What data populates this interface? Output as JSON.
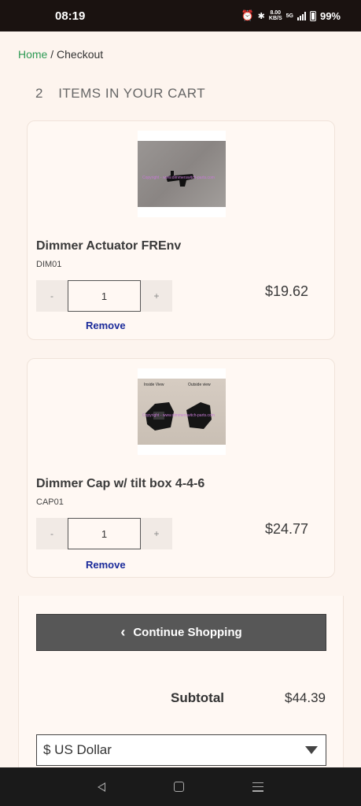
{
  "status_bar": {
    "time": "08:19",
    "net_speed": "8.00",
    "net_unit": "KB/S",
    "network_type": "5G",
    "battery": "99%"
  },
  "breadcrumb": {
    "home": "Home",
    "separator": "/",
    "current": "Checkout"
  },
  "cart": {
    "count": "2",
    "heading": "ITEMS IN YOUR CART",
    "items": [
      {
        "name": "Dimmer Actuator FREnv",
        "sku": "DIM01",
        "quantity": "1",
        "minus": "-",
        "plus": "+",
        "price": "$19.62",
        "remove": "Remove"
      },
      {
        "name": "Dimmer Cap w/ tilt box 4-4-6",
        "sku": "CAP01",
        "quantity": "1",
        "minus": "-",
        "plus": "+",
        "price": "$24.77",
        "remove": "Remove",
        "image_labels": {
          "left": "Inside View",
          "right": "Outside view"
        }
      }
    ]
  },
  "summary": {
    "continue_label": "Continue Shopping",
    "subtotal_label": "Subtotal",
    "subtotal_value": "$44.39",
    "currency": "$ US Dollar"
  },
  "icons": [
    "alarm-icon",
    "bluetooth-icon",
    "signal-icon",
    "battery-icon",
    "chevron-left-icon",
    "caret-down-icon",
    "nav-back-icon",
    "nav-home-icon",
    "nav-recents-icon"
  ],
  "colors": {
    "breadcrumb_link": "#2d9a54",
    "remove_link": "#1a2a9a",
    "continue_button": "#575757",
    "page_bg": "#fdf4ee"
  }
}
